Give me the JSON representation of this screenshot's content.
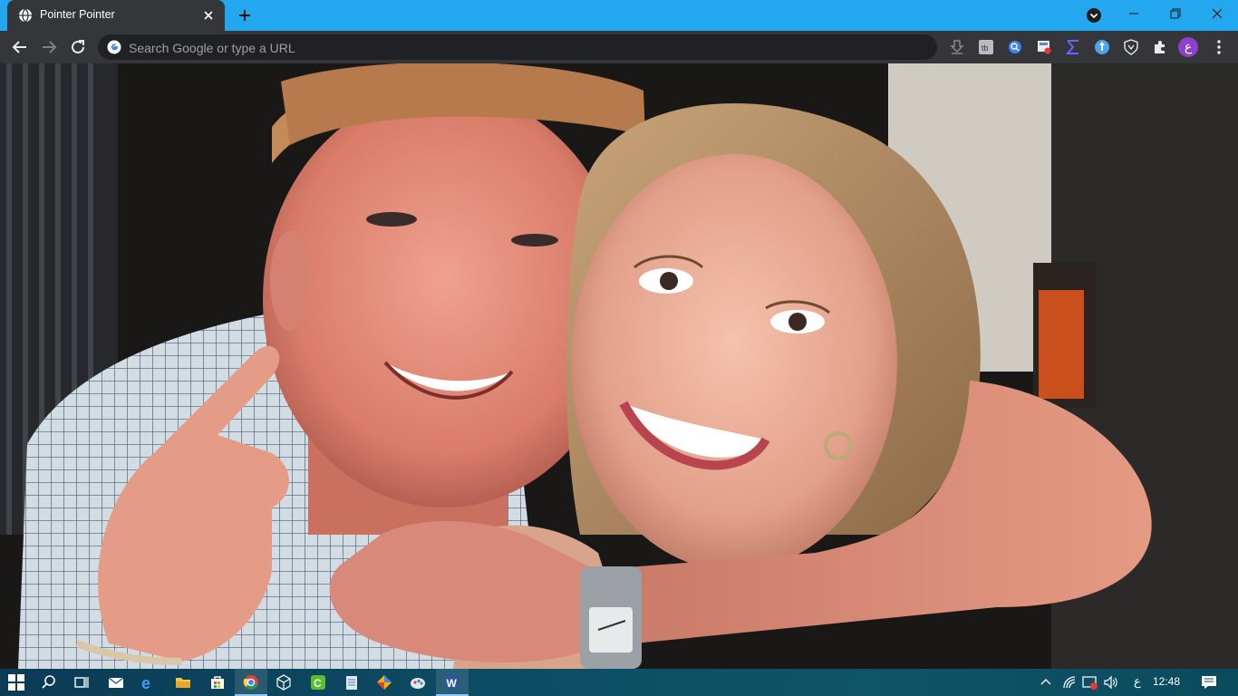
{
  "browser": {
    "tab": {
      "title": "Pointer Pointer",
      "favicon": "globe-icon",
      "close_icon": "close-icon"
    },
    "new_tab_icon": "plus-icon",
    "window_controls": [
      "minimize-icon",
      "restore-icon",
      "close-icon"
    ],
    "toolbar": {
      "back_icon": "arrow-left-icon",
      "forward_icon": "arrow-right-icon",
      "reload_icon": "reload-icon",
      "omnibox": {
        "placeholder": "Search Google or type a URL",
        "value": ""
      },
      "extensions": [
        "download-icon",
        "extension-box-icon",
        "search-compass-icon",
        "bookmark-icon",
        "sigma-icon",
        "shield-blue-icon",
        "brave-shield-icon",
        "puzzle-icon"
      ],
      "profile_letter": "ع",
      "menu_icon": "kebab-menu-icon"
    }
  },
  "content": {
    "description_icon": "photo-of-couple",
    "colors": {
      "background": "#141414",
      "shirt": "#c9d3dc",
      "skin": "#e89a8b",
      "hair": "#c9a27a"
    }
  },
  "taskbar": {
    "items": [
      "windows-start-icon",
      "search-icon",
      "task-view-icon",
      "mail-icon",
      "edge-icon",
      "file-explorer-icon",
      "store-icon",
      "chrome-icon",
      "3d-viewer-icon",
      "camtasia-icon",
      "notepad-icon",
      "color-app-icon",
      "paint-icon",
      "word-icon"
    ],
    "tray": {
      "language": "ع",
      "time": "12:48"
    },
    "colors": {
      "accent": "#23a8ef"
    }
  }
}
